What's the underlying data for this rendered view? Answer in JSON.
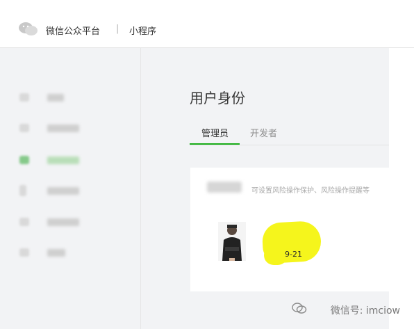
{
  "header": {
    "brand": "微信公众平台",
    "separator": "|",
    "product": "小程序"
  },
  "sidebar": {
    "items": [
      {
        "label": "",
        "active": false
      },
      {
        "label": "",
        "active": false
      },
      {
        "label": "",
        "active": true
      },
      {
        "label": "",
        "active": false
      },
      {
        "label": "",
        "active": false
      },
      {
        "label": "",
        "active": false
      }
    ]
  },
  "main": {
    "title": "用户身份",
    "tabs": [
      {
        "label": "管理员",
        "active": true
      },
      {
        "label": "开发者",
        "active": false
      }
    ],
    "card": {
      "description": "可设置风险操作保护、风险操作提醒等",
      "date_fragment": "9-21"
    }
  },
  "watermark": {
    "text": "微信号: imciow"
  },
  "colors": {
    "accent": "#1aad19",
    "highlight": "#f5f51c"
  }
}
